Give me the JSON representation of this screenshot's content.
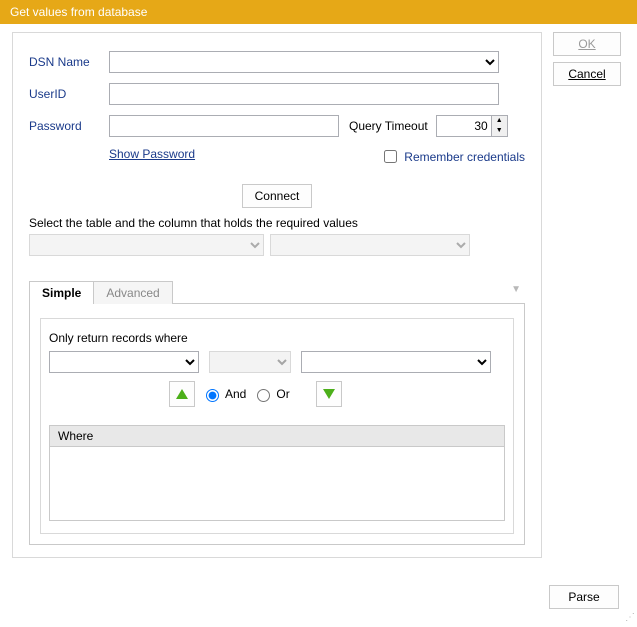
{
  "title": "Get values from database",
  "buttons": {
    "ok": "OK",
    "cancel": "Cancel",
    "connect": "Connect",
    "parse": "Parse"
  },
  "labels": {
    "dsn": "DSN Name",
    "userid": "UserID",
    "password": "Password",
    "query_timeout": "Query Timeout",
    "show_password": "Show Password",
    "remember": "Remember credentials",
    "select_table": "Select the table and the column that holds the required values",
    "only_return": "Only return records where",
    "and": "And",
    "or": "Or",
    "where": "Where"
  },
  "values": {
    "dsn": "",
    "userid": "",
    "password": "",
    "query_timeout": "30",
    "remember_checked": false,
    "andor": "And"
  },
  "tabs": {
    "simple": "Simple",
    "advanced": "Advanced",
    "active": "simple"
  }
}
